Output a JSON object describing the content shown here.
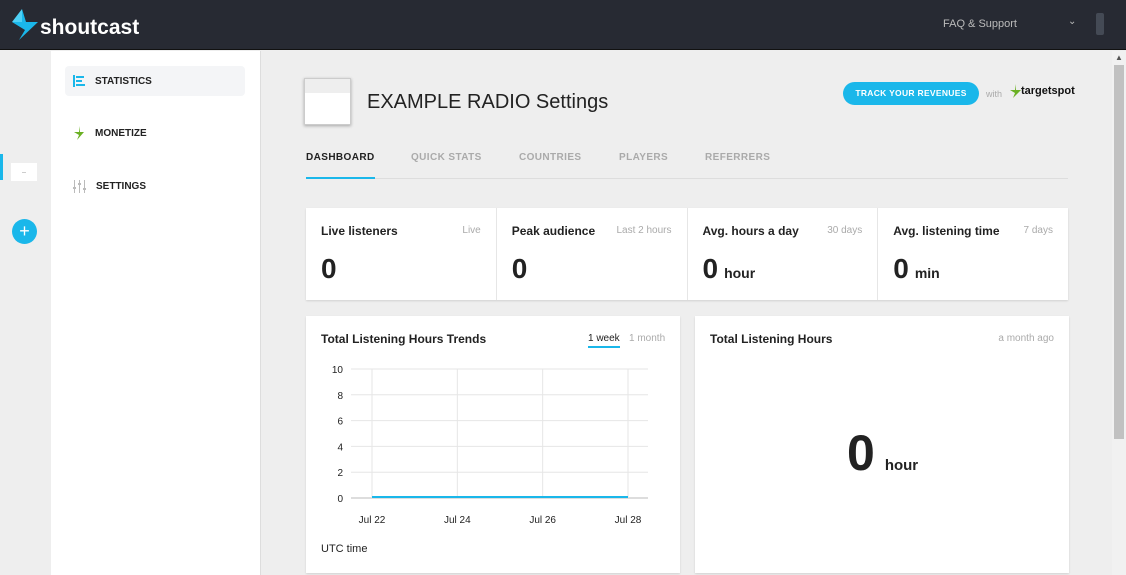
{
  "header": {
    "brand": "shoutcast",
    "faq": "FAQ & Support"
  },
  "rail": {
    "station_label": "—",
    "add": "+"
  },
  "sidebar": {
    "items": [
      {
        "label": "STATISTICS",
        "icon": "statistics-icon",
        "active": true
      },
      {
        "label": "MONETIZE",
        "icon": "lightning-icon"
      },
      {
        "label": "SETTINGS",
        "icon": "sliders-icon"
      }
    ]
  },
  "page": {
    "title": "EXAMPLE RADIO Settings",
    "track_button": "TRACK YOUR REVENUES",
    "with": "with",
    "partner": "targetspot"
  },
  "tabs": [
    {
      "label": "DASHBOARD",
      "active": true
    },
    {
      "label": "QUICK STATS"
    },
    {
      "label": "COUNTRIES"
    },
    {
      "label": "PLAYERS"
    },
    {
      "label": "REFERRERS"
    }
  ],
  "stats": [
    {
      "label": "Live listeners",
      "period": "Live",
      "value": "0",
      "unit": ""
    },
    {
      "label": "Peak audience",
      "period": "Last 2 hours",
      "value": "0",
      "unit": ""
    },
    {
      "label": "Avg. hours a day",
      "period": "30 days",
      "value": "0",
      "unit": "hour"
    },
    {
      "label": "Avg. listening time",
      "period": "7 days",
      "value": "0",
      "unit": "min"
    }
  ],
  "trends": {
    "title": "Total Listening Hours Trends",
    "ranges": [
      "1 week",
      "1 month"
    ],
    "footer": "UTC time"
  },
  "total": {
    "title": "Total Listening Hours",
    "when": "a month ago",
    "value": "0",
    "unit": "hour"
  },
  "colors": {
    "accent": "#1ab7ea",
    "header": "#272a33"
  },
  "chart_data": {
    "type": "line",
    "x": [
      "Jul 22",
      "Jul 23",
      "Jul 24",
      "Jul 25",
      "Jul 26",
      "Jul 27",
      "Jul 28"
    ],
    "xticks": [
      "Jul 22",
      "Jul 24",
      "Jul 26",
      "Jul 28"
    ],
    "values": [
      0,
      0,
      0,
      0,
      0,
      0,
      0
    ],
    "ylim": [
      0,
      10
    ],
    "yticks": [
      0,
      2,
      4,
      6,
      8,
      10
    ],
    "grid": true,
    "xlabel": "UTC time"
  }
}
